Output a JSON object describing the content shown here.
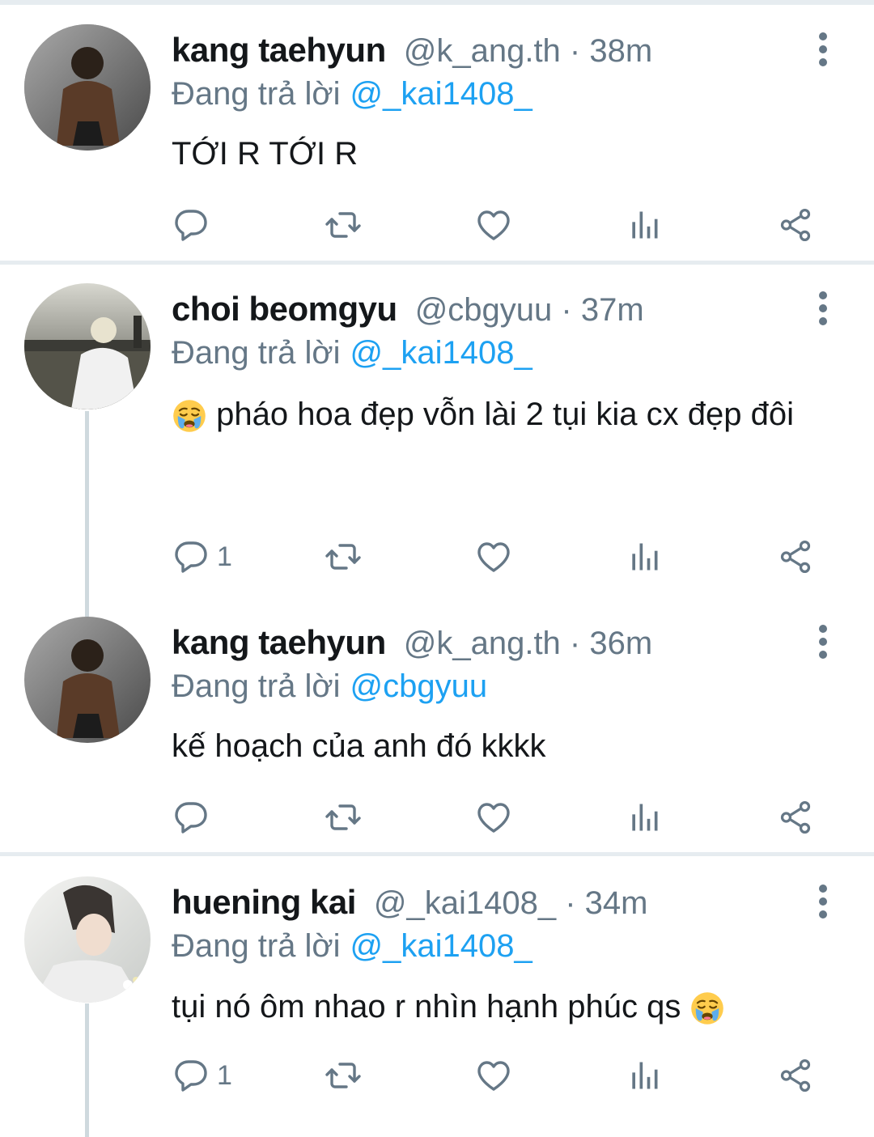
{
  "tweets": [
    {
      "name": "kang taehyun",
      "handle": "@k_ang.th · 38m",
      "reply_prefix": "Đang trả lời",
      "reply_to": "@_kai1408_",
      "text": "TỚI R TỚI R",
      "reply_count": ""
    },
    {
      "name": "choi beomgyu",
      "handle": "@cbgyuu · 37m",
      "reply_prefix": "Đang trả lời",
      "reply_to": "@_kai1408_",
      "text": "pháo hoa đẹp vỗn lài 2 tụi kia cx đẹp đôi",
      "reply_count": "1"
    },
    {
      "name": "kang taehyun",
      "handle": "@k_ang.th · 36m",
      "reply_prefix": "Đang trả lời",
      "reply_to": "@cbgyuu",
      "text": "kế hoạch của anh đó kkkk",
      "reply_count": ""
    },
    {
      "name": "huening kai",
      "handle": "@_kai1408_ · 34m",
      "reply_prefix": "Đang trả lời",
      "reply_to": "@_kai1408_",
      "text": "tụi nó ôm nhao r nhìn hạnh phúc qs",
      "reply_count": "1"
    }
  ],
  "icons": {
    "reply": "reply-icon",
    "retweet": "retweet-icon",
    "like": "like-icon",
    "analytics": "analytics-icon",
    "share": "share-icon",
    "more": "more-options-icon",
    "emoji": "loudly-crying-face-emoji"
  },
  "colors": {
    "link": "#1da1f2",
    "secondary": "#657786",
    "divider": "#e6ecf0"
  }
}
